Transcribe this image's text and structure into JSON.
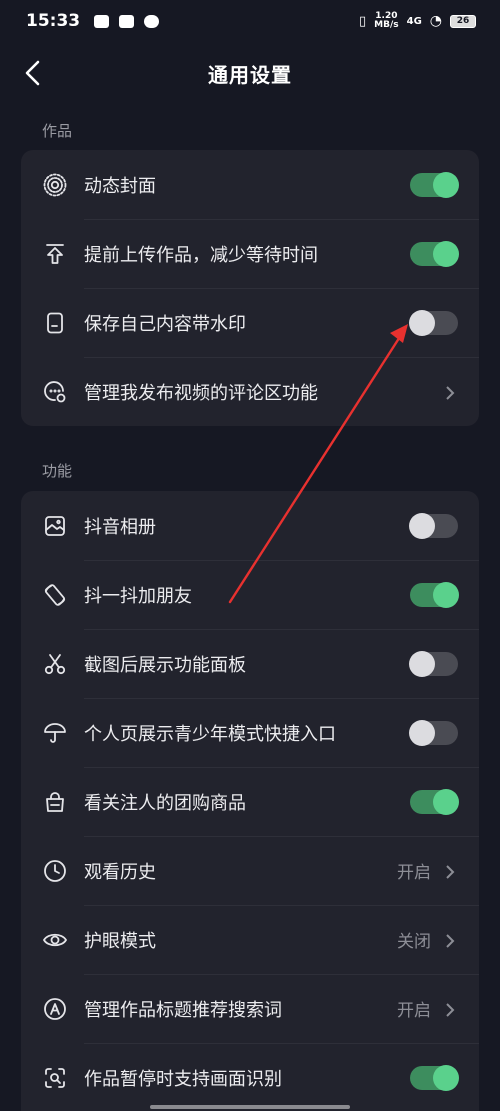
{
  "status": {
    "time": "15:33",
    "net_speed_value": "1.20",
    "net_speed_unit": "MB/s",
    "network": "4G",
    "battery": "26"
  },
  "header": {
    "title": "通用设置",
    "back_icon": "back-arrow-icon"
  },
  "sections": [
    {
      "label": "作品",
      "items": [
        {
          "label": "动态封面",
          "icon": "live-cover-icon",
          "control": "toggle",
          "on": true
        },
        {
          "label": "提前上传作品，减少等待时间",
          "icon": "upload-icon",
          "control": "toggle",
          "on": true
        },
        {
          "label": "保存自己内容带水印",
          "icon": "watermark-icon",
          "control": "toggle",
          "on": false
        },
        {
          "label": "管理我发布视频的评论区功能",
          "icon": "comment-settings-icon",
          "control": "chevron"
        }
      ]
    },
    {
      "label": "功能",
      "items": [
        {
          "label": "抖音相册",
          "icon": "album-icon",
          "control": "toggle",
          "on": false
        },
        {
          "label": "抖一抖加朋友",
          "icon": "shake-icon",
          "control": "toggle",
          "on": true
        },
        {
          "label": "截图后展示功能面板",
          "icon": "scissors-icon",
          "control": "toggle",
          "on": false
        },
        {
          "label": "个人页展示青少年模式快捷入口",
          "icon": "umbrella-icon",
          "control": "toggle",
          "on": false
        },
        {
          "label": "看关注人的团购商品",
          "icon": "shopping-bag-icon",
          "control": "toggle",
          "on": true
        },
        {
          "label": "观看历史",
          "icon": "clock-icon",
          "control": "chevron",
          "value": "开启"
        },
        {
          "label": "护眼模式",
          "icon": "eye-icon",
          "control": "chevron",
          "value": "关闭"
        },
        {
          "label": "管理作品标题推荐搜索词",
          "icon": "search-tag-icon",
          "control": "chevron",
          "value": "开启"
        },
        {
          "label": "作品暂停时支持画面识别",
          "icon": "scan-icon",
          "control": "toggle",
          "on": true
        }
      ]
    }
  ],
  "colors": {
    "background": "#161823",
    "card": "#22232d",
    "toggle_on": "#5ad18c",
    "toggle_off": "#4a4b53",
    "annotation_arrow": "#e8312f"
  }
}
